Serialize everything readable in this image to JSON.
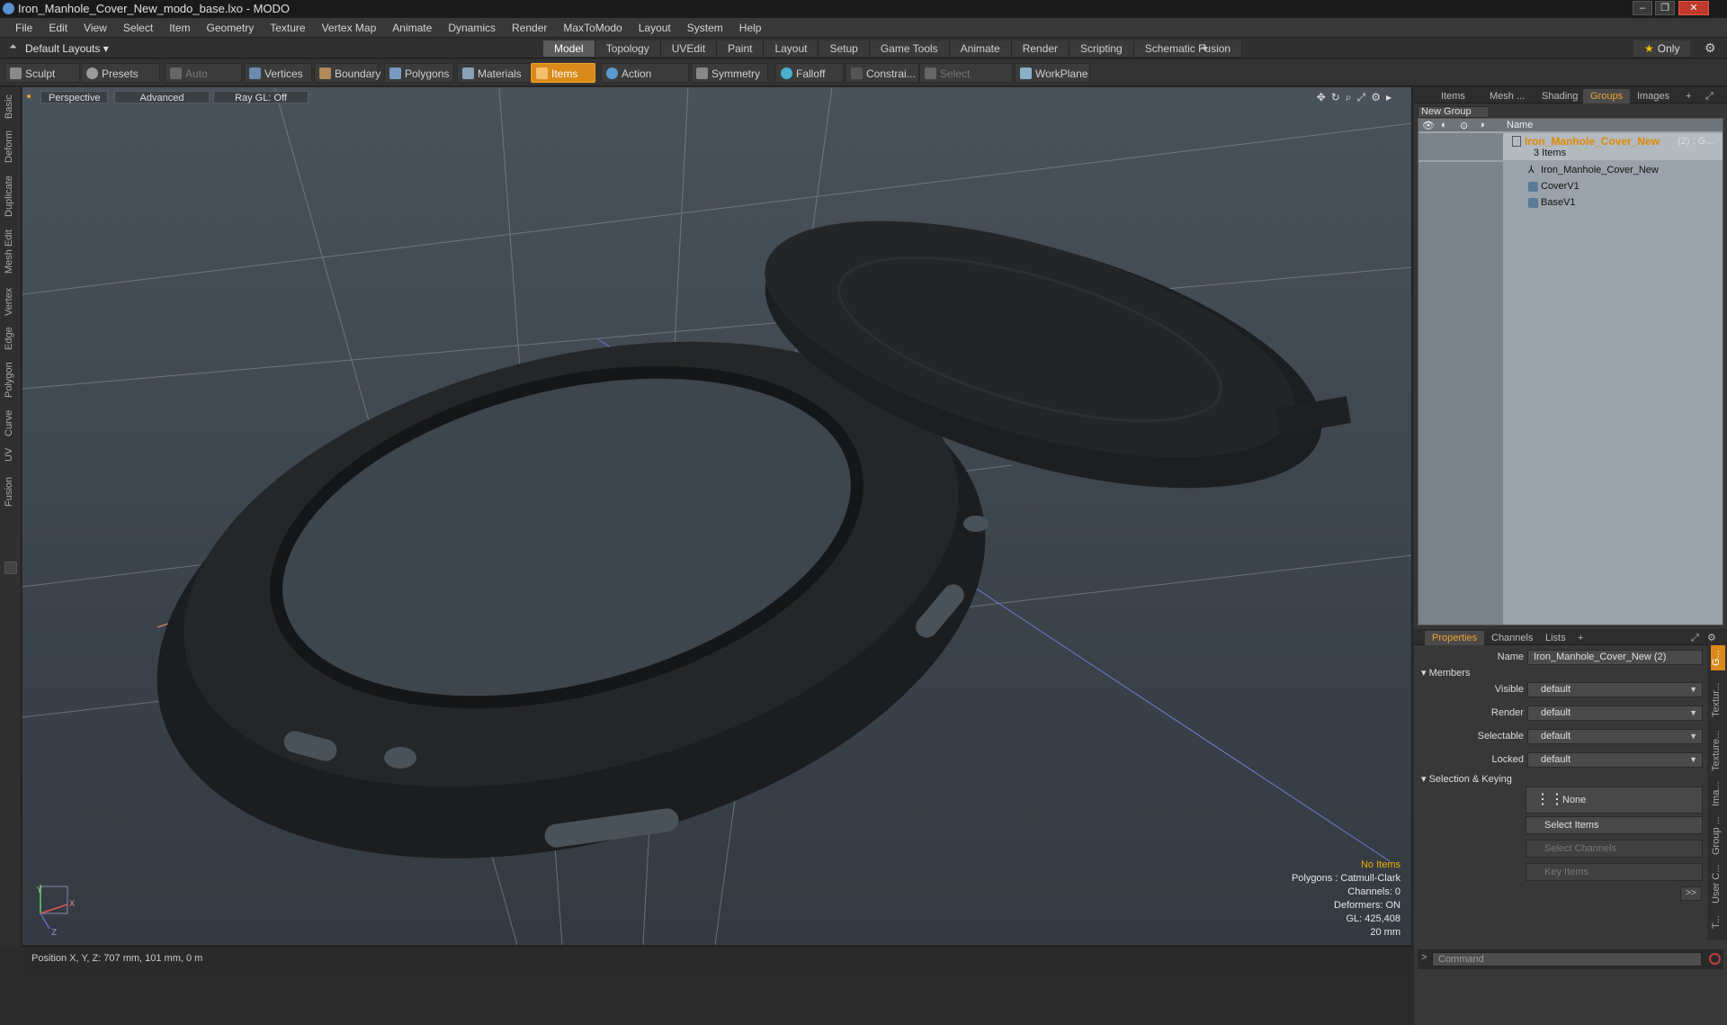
{
  "window": {
    "title": "Iron_Manhole_Cover_New_modo_base.lxo - MODO",
    "minimize": "–",
    "maximize": "❐",
    "close": "✕"
  },
  "menu": [
    "File",
    "Edit",
    "View",
    "Select",
    "Item",
    "Geometry",
    "Texture",
    "Vertex Map",
    "Animate",
    "Dynamics",
    "Render",
    "MaxToModo",
    "Layout",
    "System",
    "Help"
  ],
  "layout": {
    "default_layouts": "Default Layouts ▾",
    "tabs": [
      "Model",
      "Topology",
      "UVEdit",
      "Paint",
      "Layout",
      "Setup",
      "Game Tools",
      "Animate",
      "Render",
      "Scripting",
      "Schematic Fusion"
    ],
    "active_tab": "Model",
    "plus": "+",
    "only_star": "★",
    "only_label": "Only"
  },
  "toolbar": {
    "sculpt": "Sculpt",
    "presets": "Presets",
    "auto_select": "Auto Select",
    "vertices": "Vertices",
    "boundary": "Boundary",
    "polygons": "Polygons",
    "materials": "Materials",
    "items": "Items",
    "action_center": "Action Center",
    "symmetry": "Symmetry",
    "falloff": "Falloff",
    "constrain": "Constrai...",
    "select_through": "Select Through",
    "workplane": "WorkPlane"
  },
  "left_tabs": [
    "Basic",
    "Deform",
    "Duplicate",
    "Mesh Edit",
    "Vertex",
    "Edge",
    "Polygon",
    "Curve",
    "UV",
    "Fusion"
  ],
  "viewport": {
    "perspective": "Perspective",
    "advanced": "Advanced",
    "raygl": "Ray GL: Off",
    "info": {
      "no_items": "No Items",
      "polygons": "Polygons : Catmull-Clark",
      "channels": "Channels: 0",
      "deformers": "Deformers: ON",
      "gl": "GL: 425,408",
      "scale": "20 mm"
    },
    "axes": {
      "y": "Y",
      "x": "X",
      "z": "Z"
    }
  },
  "status": {
    "position": "Position X, Y, Z:  707 mm, 101 mm, 0 m"
  },
  "top_panel": {
    "tabs": [
      "Items",
      "Mesh ...",
      "Shading",
      "Groups",
      "Images"
    ],
    "active_tab": "Groups",
    "new_group": "New Group",
    "name_col": "Name",
    "group_name": "Iron_Manhole_Cover_New",
    "group_suffix": "(2) : G...",
    "item_count": "3 Items",
    "children": [
      "Iron_Manhole_Cover_New",
      "CoverV1",
      "BaseV1"
    ]
  },
  "properties": {
    "tabs": [
      "Properties",
      "Channels",
      "Lists"
    ],
    "name_label": "Name",
    "name_value": "Iron_Manhole_Cover_New (2)",
    "members": "Members",
    "visible_label": "Visible",
    "visible_value": "default",
    "render_label": "Render",
    "render_value": "default",
    "selectable_label": "Selectable",
    "selectable_value": "default",
    "locked_label": "Locked",
    "locked_value": "default",
    "selection_keying": "Selection & Keying",
    "none_btn": "None",
    "select_items": "Select Items",
    "select_channels": "Select Channels",
    "key_items": "Key Items",
    "more": ">>"
  },
  "right_vertical_tabs": [
    "G...",
    "Textur...",
    "Texture...",
    "Ima...",
    "Group ...",
    "User C...",
    "T..."
  ],
  "command": {
    "placeholder": "Command",
    "prompt": ">"
  },
  "colors": {
    "accent": "#d98a1a",
    "highlight": "#f0b400",
    "viewport_top": "#49525b"
  }
}
